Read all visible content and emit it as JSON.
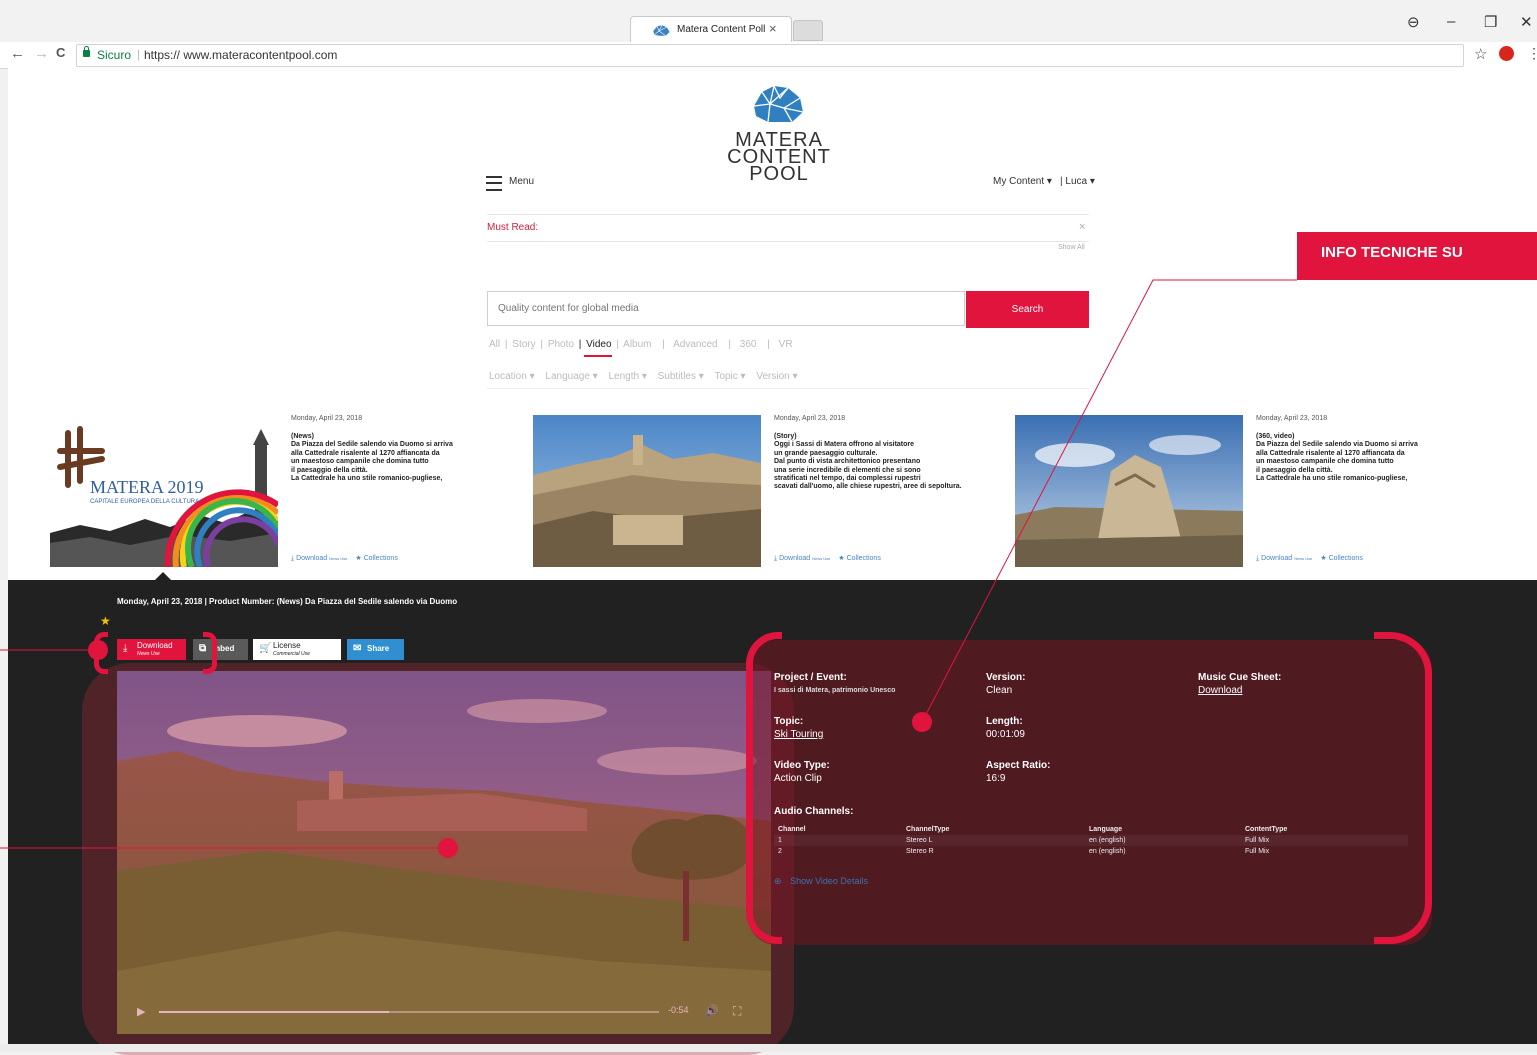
{
  "browser": {
    "tab_title": "Matera Content Poll",
    "tab_close": "×",
    "secure_label": "Sicuro",
    "url": "https:// www.materacontentpool.com",
    "window_buttons": [
      "⊖",
      "–",
      "❐",
      "✕"
    ],
    "nav_glyphs": [
      "←",
      "→",
      "C"
    ],
    "bookmark_star": "☆",
    "more_menu": "⋮"
  },
  "site": {
    "logo_lines": [
      "MATERA",
      "CONTENT",
      "POOL"
    ],
    "menu_label": "Menu",
    "my_content": "My Content ▾",
    "user": "| Luca ▾",
    "must_read": "Must Read:",
    "must_read_close": "×",
    "show_all": "Show All",
    "search_placeholder": "Quality content for global media",
    "search_button": "Search",
    "type_filters": [
      "All",
      "|",
      "Story",
      "|",
      "Photo",
      "|",
      "Video",
      "|",
      "Album",
      "|",
      "Advanced",
      "|",
      "360",
      "|",
      "VR"
    ],
    "dropdown_filters": [
      "Location ▾",
      "Language ▾",
      "Length ▾",
      "Subtitles ▾",
      "Topic ▾",
      "Version ▾"
    ],
    "accent_color": "#e0143d"
  },
  "cards": [
    {
      "date": "Monday, April 23, 2018",
      "text": "(News)\nDa Piazza del Sedile salendo via Duomo si arriva\nalla Cattedrale risalente al 1270 affiancata da\nun maestoso campanile che domina tutto\nil paesaggio della città.\nLa Cattedrale ha uno stile romanico-pugliese,",
      "logo_title": "MATERA 2019",
      "logo_sub": "CAPITALE EUROPEA DELLA CULTURA",
      "download": "Download",
      "download_sub": "News Use",
      "collections": "Collections"
    },
    {
      "date": "Monday, April 23, 2018",
      "text": "(Story)\nOggi i Sassi di Matera offrono al visitatore\nun grande paesaggio culturale.\nDal punto di vista architettonico presentano\nuna serie incredibile di elementi che si sono\nstratificati nel tempo, dai complessi rupestri\nscavati dall'uomo, alle chiese rupestri, aree di sepoltura.",
      "download": "Download",
      "download_sub": "News Use",
      "collections": "Collections"
    },
    {
      "date": "Monday, April 23, 2018",
      "text": "(360, video)\nDa Piazza del Sedile salendo via Duomo si arriva\nalla Cattedrale risalente al 1270 affiancata da\nun maestoso campanile che domina tutto\nil paesaggio della città.\nLa Cattedrale ha uno stile romanico-pugliese,",
      "download": "Download",
      "download_sub": "News Use",
      "collections": "Collections"
    }
  ],
  "detail": {
    "meta": "Monday, April 23, 2018 | Product Number: (News) Da Piazza del Sedile salendo via Duomo",
    "download": "Download",
    "download_sub": "News Use",
    "embed": "mbed",
    "license": "License",
    "license_sub": "Commercial Use",
    "share": "Share",
    "time_left": "-0:54",
    "progress_fraction": 0.46
  },
  "tech_info": {
    "project_label": "Project / Event:",
    "project_value": "I sassi di Matera, patrimonio Unesco",
    "version_label": "Version:",
    "version_value": "Clean",
    "music_label": "Music Cue Sheet:",
    "music_value": "Download",
    "topic_label": "Topic:",
    "topic_value": "Ski Touring",
    "length_label": "Length:",
    "length_value": "00:01:09",
    "video_type_label": "Video Type:",
    "video_type_value": "Action Clip",
    "aspect_label": "Aspect Ratio:",
    "aspect_value": "16:9",
    "audio_label": "Audio Channels:",
    "audio_headers": [
      "Channel",
      "ChannelType",
      "Language",
      "ContentType"
    ],
    "audio_rows": [
      [
        "1",
        "Stereo L",
        "en (english)",
        "Full Mix"
      ],
      [
        "2",
        "Stereo R",
        "en (english)",
        "Full Mix"
      ]
    ],
    "show_details": "Show Video Details"
  },
  "callout": {
    "text": "INFO TECNICHE SU"
  }
}
